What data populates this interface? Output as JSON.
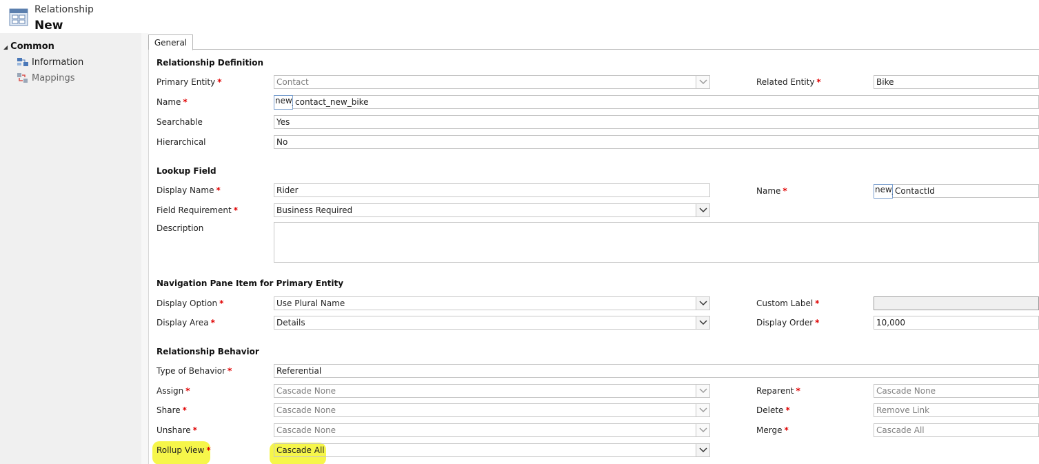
{
  "header": {
    "entity": "Relationship",
    "title": "New"
  },
  "nav": {
    "group": "Common",
    "items": [
      {
        "label": "Information",
        "icon": "information-icon"
      },
      {
        "label": "Mappings",
        "icon": "mappings-icon"
      }
    ]
  },
  "tabs": [
    "General"
  ],
  "definition": {
    "title": "Relationship Definition",
    "primary_entity_label": "Primary Entity",
    "primary_entity_value": "Contact",
    "related_entity_label": "Related Entity",
    "related_entity_value": "Bike",
    "name_label": "Name",
    "name_prefix": "new_",
    "name_value": "contact_new_bike",
    "searchable_label": "Searchable",
    "searchable_value": "Yes",
    "hierarchical_label": "Hierarchical",
    "hierarchical_value": "No"
  },
  "lookup": {
    "title": "Lookup Field",
    "display_name_label": "Display Name",
    "display_name_value": "Rider",
    "name_label": "Name",
    "name_prefix": "new_",
    "name_value": "ContactId",
    "requirement_label": "Field Requirement",
    "requirement_value": "Business Required",
    "description_label": "Description",
    "description_value": ""
  },
  "navpane": {
    "title": "Navigation Pane Item for Primary Entity",
    "display_option_label": "Display Option",
    "display_option_value": "Use Plural Name",
    "custom_label_label": "Custom Label",
    "custom_label_value": "",
    "display_area_label": "Display Area",
    "display_area_value": "Details",
    "display_order_label": "Display Order",
    "display_order_value": "10,000"
  },
  "behavior": {
    "title": "Relationship Behavior",
    "type_label": "Type of Behavior",
    "type_value": "Referential",
    "assign_label": "Assign",
    "assign_value": "Cascade None",
    "reparent_label": "Reparent",
    "reparent_value": "Cascade None",
    "share_label": "Share",
    "share_value": "Cascade None",
    "delete_label": "Delete",
    "delete_value": "Remove Link",
    "unshare_label": "Unshare",
    "unshare_value": "Cascade None",
    "merge_label": "Merge",
    "merge_value": "Cascade All",
    "rollup_label": "Rollup View",
    "rollup_value": "Cascade All"
  },
  "required_marker": "*",
  "colors": {
    "required": "#e00000",
    "highlight": "#f6f64a",
    "nav_background": "#f0f0f0"
  }
}
